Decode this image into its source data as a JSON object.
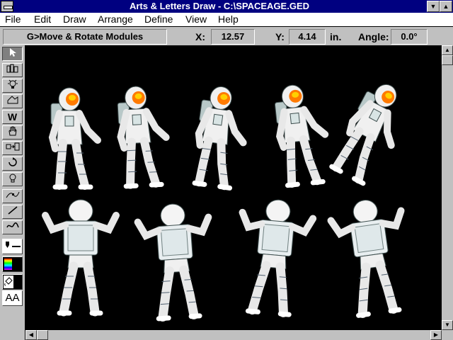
{
  "window": {
    "title": "Arts & Letters Draw - C:\\SPACEAGE.GED"
  },
  "menubar": {
    "items": [
      "File",
      "Edit",
      "Draw",
      "Arrange",
      "Define",
      "View",
      "Help"
    ]
  },
  "statusbar": {
    "mode": "G>Move & Rotate Modules",
    "x_label": "X:",
    "x_value": "12.57",
    "y_label": "Y:",
    "y_value": "4.14",
    "unit": "in.",
    "angle_label": "Angle:",
    "angle_value": "0.0°"
  },
  "toolbox": {
    "tools": [
      "pointer-icon",
      "symbol-library-icon",
      "lightbulb-icon",
      "shapes-icon",
      "w-tool-icon",
      "hand-icon",
      "transform-icon",
      "rotate-icon",
      "bulb-select-icon",
      "node-path-icon",
      "line-icon",
      "freehand-icon",
      "pen-style-icon",
      "color-palette-icon",
      "fill-icon",
      "text-icon"
    ],
    "text_tool_label": "AA"
  },
  "canvas": {
    "background": "#000000",
    "astronaut_count": 9
  },
  "colors": {
    "titlebar": "#000080",
    "face": "#c0c0c0",
    "visor": "#ff8000",
    "suit": "#f0f0f0"
  }
}
